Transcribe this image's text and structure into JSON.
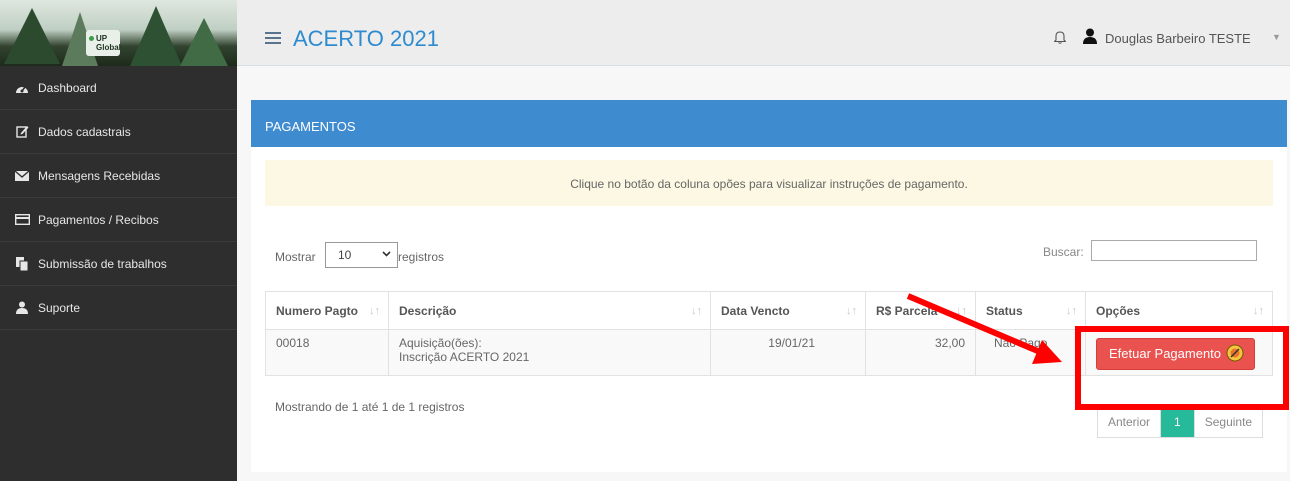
{
  "sidebar": {
    "logo_text": "UP Global",
    "items": [
      {
        "label": "Dashboard",
        "icon": "dashboard-icon"
      },
      {
        "label": "Dados cadastrais",
        "icon": "edit-icon"
      },
      {
        "label": "Mensagens Recebidas",
        "icon": "envelope-icon"
      },
      {
        "label": "Pagamentos / Recibos",
        "icon": "credit-card-icon"
      },
      {
        "label": "Submissão de trabalhos",
        "icon": "files-icon"
      },
      {
        "label": "Suporte",
        "icon": "user-icon"
      }
    ]
  },
  "header": {
    "title": "ACERTO 2021",
    "user_name": "Douglas Barbeiro TESTE"
  },
  "panel": {
    "title": "PAGAMENTOS",
    "alert": "Clique no botão da coluna opões para visualizar instruções de pagamento."
  },
  "table_controls": {
    "show_label": "Mostrar",
    "page_length": "10",
    "records_label": "registros",
    "search_label": "Buscar:",
    "search_value": ""
  },
  "table": {
    "headers": [
      "Numero Pagto",
      "Descrição",
      "Data Vencto",
      "R$ Parcela",
      "Status",
      "Opções"
    ],
    "rows": [
      {
        "numero": "00018",
        "descricao_l1": "Aquisição(ões):",
        "descricao_l2": "Inscrição ACERTO 2021",
        "data": "19/01/21",
        "parcela": "32,00",
        "status": "Não Pago",
        "action_label": "Efetuar Pagamento"
      }
    ]
  },
  "footer": {
    "info": "Mostrando de 1 até 1 de 1 registros",
    "prev": "Anterior",
    "page": "1",
    "next": "Seguinte"
  },
  "colors": {
    "sidebar_bg": "#2e2e2e",
    "panel_header": "#3e8bd0",
    "title_blue": "#2e8bd0",
    "alert_bg": "#fcf8e3",
    "danger_button": "#e9524f",
    "pager_active": "#26b99a",
    "annotation_red": "#ff0000"
  }
}
